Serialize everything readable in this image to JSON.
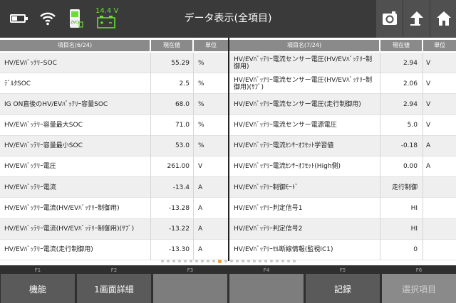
{
  "topbar": {
    "title": "データ表示(全項目)",
    "voltage": "14.4 V",
    "vci_label": "ZVCI",
    "icons": [
      "battery-icon",
      "wifi-icon",
      "vci-icon",
      "car-battery-icon",
      "camera-icon",
      "upload-icon",
      "home-icon"
    ]
  },
  "left_table": {
    "headers": {
      "name": "項目名(6/24)",
      "value": "現在値",
      "unit": "単位"
    },
    "rows": [
      {
        "name": "HV/EVﾊﾞｯﾃﾘｰSOC",
        "value": "55.29",
        "unit": "%"
      },
      {
        "name": "ﾃﾞﾙﾀSOC",
        "value": "2.5",
        "unit": "%"
      },
      {
        "name": "IG ON直後のHV/EVﾊﾞｯﾃﾘｰ容量SOC",
        "value": "68.0",
        "unit": "%"
      },
      {
        "name": "HV/EVﾊﾞｯﾃﾘｰ容量最大SOC",
        "value": "71.0",
        "unit": "%"
      },
      {
        "name": "HV/EVﾊﾞｯﾃﾘｰ容量最小SOC",
        "value": "53.0",
        "unit": "%"
      },
      {
        "name": "HV/EVﾊﾞｯﾃﾘｰ電圧",
        "value": "261.00",
        "unit": "V"
      },
      {
        "name": "HV/EVﾊﾞｯﾃﾘｰ電流",
        "value": "-13.4",
        "unit": "A"
      },
      {
        "name": "HV/EVﾊﾞｯﾃﾘｰ電流(HV/EVﾊﾞｯﾃﾘｰ制御用)",
        "value": "-13.28",
        "unit": "A"
      },
      {
        "name": "HV/EVﾊﾞｯﾃﾘｰ電流(HV/EVﾊﾞｯﾃﾘｰ制御用)(ｻﾌﾞ)",
        "value": "-13.22",
        "unit": "A"
      },
      {
        "name": "HV/EVﾊﾞｯﾃﾘｰ電流(走行制御用)",
        "value": "-13.30",
        "unit": "A"
      }
    ]
  },
  "right_table": {
    "headers": {
      "name": "項目名(7/24)",
      "value": "現在値",
      "unit": "単位"
    },
    "rows": [
      {
        "name": "HV/EVﾊﾞｯﾃﾘｰ電流センサー電圧(HV/EVﾊﾞｯﾃﾘｰ制御用)",
        "value": "2.94",
        "unit": "V"
      },
      {
        "name": "HV/EVﾊﾞｯﾃﾘｰ電流センサー電圧(HV/EVﾊﾞｯﾃﾘｰ制御用)(ｻﾌﾞ)",
        "value": "2.06",
        "unit": "V"
      },
      {
        "name": "HV/EVﾊﾞｯﾃﾘｰ電流センサー電圧(走行制御用)",
        "value": "2.94",
        "unit": "V"
      },
      {
        "name": "HV/EVﾊﾞｯﾃﾘｰ電流センサー電源電圧",
        "value": "5.0",
        "unit": "V"
      },
      {
        "name": "HV/EVﾊﾞｯﾃﾘｰ電流ｾﾝｻｰｵﾌｾｯﾄ学習値",
        "value": "-0.18",
        "unit": "A"
      },
      {
        "name": "HV/EVﾊﾞｯﾃﾘｰ電流ｾﾝｻｰｵﾌｾｯﾄ(High側)",
        "value": "0.00",
        "unit": "A"
      },
      {
        "name": "HV/EVﾊﾞｯﾃﾘｰ制御ﾓｰﾄﾞ",
        "value": "走行制御",
        "unit": ""
      },
      {
        "name": "HV/EVﾊﾞｯﾃﾘｰ判定信号1",
        "value": "HI",
        "unit": ""
      },
      {
        "name": "HV/EVﾊﾞｯﾃﾘｰ判定信号2",
        "value": "HI",
        "unit": ""
      },
      {
        "name": "HV/EVﾊﾞｯﾃﾘｰｾﾙ断線情報(監視IC1)",
        "value": "0",
        "unit": ""
      }
    ]
  },
  "pager": {
    "total": 24,
    "active": 10
  },
  "fkeys": [
    {
      "key": "F1",
      "label": "機能",
      "state": "normal"
    },
    {
      "key": "F2",
      "label": "1画面詳細",
      "state": "normal"
    },
    {
      "key": "F3",
      "label": "",
      "state": "empty"
    },
    {
      "key": "F4",
      "label": "",
      "state": "empty"
    },
    {
      "key": "F5",
      "label": "記録",
      "state": "normal"
    },
    {
      "key": "F6",
      "label": "選択項目",
      "state": "dim"
    }
  ],
  "colors": {
    "topbar": "#3a3a3a",
    "accent_green": "#66e033",
    "active_dot": "#f0a030"
  }
}
